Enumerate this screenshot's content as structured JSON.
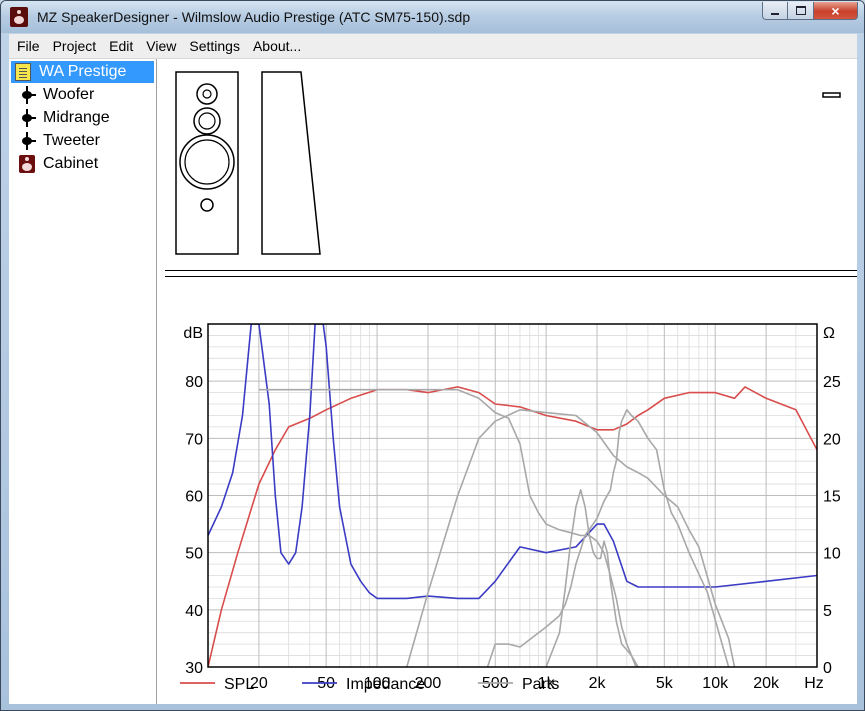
{
  "window": {
    "title": "MZ SpeakerDesigner - Wilmslow Audio Prestige (ATC SM75-150).sdp",
    "icon": "speaker-app-icon",
    "controls": {
      "minimize": "minimize-icon",
      "maximize": "maximize-icon",
      "close": "×"
    }
  },
  "menu": [
    "File",
    "Project",
    "Edit",
    "View",
    "Settings",
    "About..."
  ],
  "tree": {
    "items": [
      {
        "label": "WA Prestige",
        "icon": "project-icon",
        "selected": true
      },
      {
        "label": "Woofer",
        "icon": "driver-icon",
        "selected": false
      },
      {
        "label": "Midrange",
        "icon": "driver-icon",
        "selected": false
      },
      {
        "label": "Tweeter",
        "icon": "driver-icon",
        "selected": false
      },
      {
        "label": "Cabinet",
        "icon": "cabinet-icon",
        "selected": false
      }
    ]
  },
  "colors": {
    "spl": "#d94c4c",
    "impedance": "#3b3bc4",
    "parts": "#a8a8a8",
    "selection": "#3399ff"
  },
  "chart_data": {
    "type": "line",
    "x_scale": "log",
    "x_unit_label": "Hz",
    "xlim": [
      10,
      40000
    ],
    "x_ticks": [
      20,
      50,
      100,
      200,
      500,
      1000,
      2000,
      5000,
      10000,
      20000
    ],
    "x_tick_labels": [
      "20",
      "50",
      "100",
      "200",
      "500",
      "1k",
      "2k",
      "5k",
      "10k",
      "20k"
    ],
    "y_left": {
      "label": "dB",
      "lim": [
        30,
        90
      ],
      "ticks": [
        30,
        40,
        50,
        60,
        70,
        80
      ]
    },
    "y_right": {
      "label": "Ω",
      "lim": [
        0,
        30
      ],
      "ticks": [
        0,
        5,
        10,
        15,
        20,
        25
      ]
    },
    "grid": true,
    "legend": "bottom",
    "series": [
      {
        "name": "SPL",
        "axis": "left",
        "x": [
          10,
          12,
          15,
          20,
          25,
          30,
          40,
          50,
          70,
          100,
          150,
          200,
          300,
          400,
          500,
          700,
          1000,
          1500,
          2000,
          2500,
          3000,
          3500,
          4000,
          5000,
          7000,
          10000,
          13000,
          15000,
          20000,
          30000,
          40000
        ],
        "y": [
          30,
          40,
          50,
          62,
          68,
          72,
          73.5,
          75,
          77,
          78.5,
          78.5,
          78,
          79,
          78,
          76,
          75.5,
          74,
          73,
          71.5,
          71.5,
          72.5,
          74,
          75,
          77,
          78,
          78,
          77,
          79,
          77,
          75,
          68
        ]
      },
      {
        "name": "Impedance",
        "axis": "right",
        "x": [
          10,
          12,
          14,
          16,
          18,
          20,
          23,
          25,
          27,
          30,
          33,
          36,
          40,
          43,
          45,
          47,
          48,
          50,
          55,
          60,
          70,
          80,
          90,
          100,
          120,
          150,
          200,
          300,
          400,
          500,
          700,
          1000,
          1500,
          2000,
          2200,
          2500,
          3000,
          3500,
          4000,
          5000,
          7000,
          10000,
          20000,
          40000
        ],
        "y": [
          11.5,
          14,
          17,
          22,
          30,
          30,
          23,
          15,
          10,
          9,
          10,
          14,
          22,
          30,
          30,
          30,
          30,
          28,
          20,
          14,
          9,
          7.5,
          6.5,
          6,
          6,
          6,
          6.2,
          6,
          6,
          7.5,
          10.5,
          10,
          10.5,
          12.5,
          12.5,
          11,
          7.5,
          7,
          7,
          7,
          7,
          7,
          7.5,
          8
        ]
      },
      {
        "name": "Parts",
        "axis": "left",
        "x": [
          20,
          50,
          100,
          200,
          300,
          400,
          500,
          600,
          700,
          800,
          900,
          1000,
          1200,
          1400,
          1600,
          1800,
          2000,
          2200,
          2400,
          2600,
          2800,
          3000,
          3200,
          3400
        ],
        "y": [
          78.5,
          78.5,
          78.5,
          78.5,
          78.5,
          77,
          74.5,
          73.5,
          69,
          60,
          57,
          55,
          54,
          53.5,
          53,
          53,
          52,
          50,
          46,
          42,
          37,
          34,
          32,
          30
        ]
      },
      {
        "name": "Parts",
        "axis": "left",
        "x": [
          150,
          200,
          300,
          400,
          500,
          700,
          1000,
          1500,
          2000,
          2500,
          3000,
          3500,
          4000,
          5000,
          6000,
          7000,
          8000,
          10000,
          12000,
          13000
        ],
        "y": [
          30,
          43,
          60,
          70,
          73,
          75,
          74.5,
          74,
          71,
          67,
          65,
          64,
          63,
          60,
          58,
          54,
          51,
          41,
          35,
          30
        ]
      },
      {
        "name": "Parts",
        "axis": "left",
        "x": [
          450,
          500,
          600,
          700,
          1000,
          1200,
          1300,
          1400,
          1500,
          1700,
          2000,
          2200,
          2400,
          2500,
          2600,
          2700,
          2800,
          3000,
          3200,
          3500,
          4000,
          4500,
          5000,
          5500,
          6000,
          7000,
          9000,
          12000
        ],
        "y": [
          30,
          34,
          34,
          33.5,
          37,
          39,
          41,
          44,
          48,
          53,
          56,
          59,
          61,
          64,
          66,
          71,
          73,
          75,
          74,
          73,
          70,
          68,
          61,
          57,
          55,
          50,
          43,
          30
        ]
      },
      {
        "name": "Parts",
        "axis": "left",
        "x": [
          1000,
          1200,
          1300,
          1400,
          1500,
          1600,
          1700,
          1800,
          1900,
          2000,
          2100,
          2200,
          2300,
          2400,
          2600,
          2800,
          3000,
          3200,
          3500,
          3800,
          4000
        ],
        "y": [
          30,
          36,
          44,
          52,
          58,
          61,
          58,
          53,
          50,
          49,
          49,
          52,
          50,
          45,
          38,
          34,
          33,
          32,
          30,
          30,
          30
        ]
      }
    ]
  },
  "preview": {
    "label": "cabinet-front-and-side-view"
  }
}
